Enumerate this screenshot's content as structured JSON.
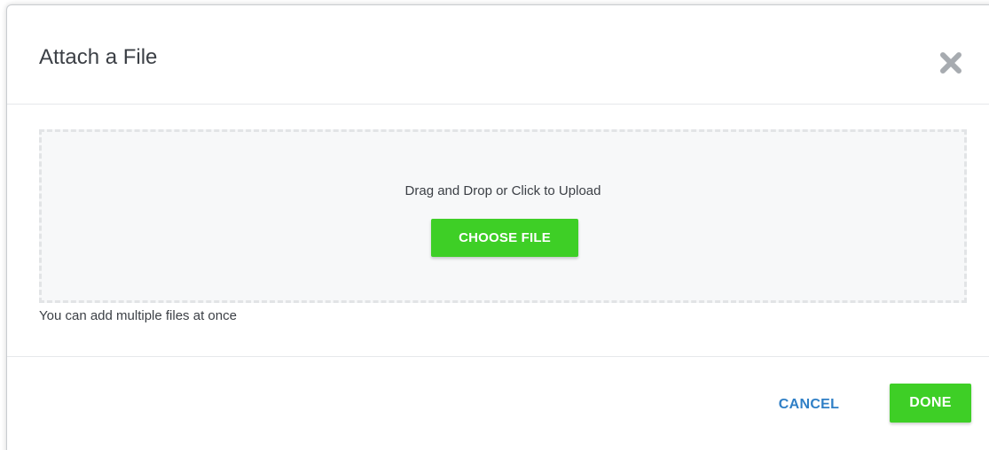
{
  "dialog": {
    "title": "Attach a File",
    "close_icon": "close-x-icon"
  },
  "dropzone": {
    "instruction": "Drag and Drop or Click to Upload",
    "choose_file_label": "CHOOSE FILE"
  },
  "hint": "You can add multiple files at once",
  "footer": {
    "cancel_label": "CANCEL",
    "done_label": "DONE"
  },
  "colors": {
    "accent_green": "#3ecf26",
    "link_blue": "#2f7fc6",
    "text": "#3b3f45",
    "dropzone_bg": "#f7f8f9",
    "close_icon": "#a7abb0"
  }
}
